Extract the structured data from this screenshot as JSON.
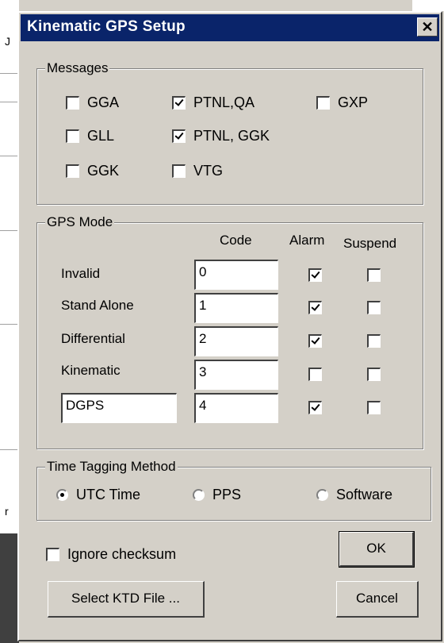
{
  "dialog": {
    "title": "Kinematic GPS Setup",
    "close_glyph": "✕"
  },
  "messages": {
    "legend": "Messages",
    "items": [
      {
        "label": "GGA",
        "checked": false
      },
      {
        "label": "PTNL,QA",
        "checked": true
      },
      {
        "label": "GXP",
        "checked": false
      },
      {
        "label": "GLL",
        "checked": false
      },
      {
        "label": "PTNL, GGK",
        "checked": true
      },
      {
        "label": "GGK",
        "checked": false
      },
      {
        "label": "VTG",
        "checked": false
      }
    ]
  },
  "gps_mode": {
    "legend": "GPS Mode",
    "headers": {
      "code": "Code",
      "alarm": "Alarm",
      "suspend": "Suspend"
    },
    "rows": [
      {
        "name": "Invalid",
        "code": "0",
        "alarm": true,
        "suspend": false
      },
      {
        "name": "Stand Alone",
        "code": "1",
        "alarm": true,
        "suspend": false
      },
      {
        "name": "Differential",
        "code": "2",
        "alarm": true,
        "suspend": false
      },
      {
        "name": "Kinematic",
        "code": "3",
        "alarm": false,
        "suspend": false
      },
      {
        "name": "DGPS",
        "code": "4",
        "alarm": true,
        "suspend": false
      }
    ]
  },
  "time_tagging": {
    "legend": "Time Tagging Method",
    "options": [
      {
        "label": "UTC Time",
        "selected": true
      },
      {
        "label": "PPS",
        "selected": false
      },
      {
        "label": "Software",
        "selected": false
      }
    ]
  },
  "ignore_checksum": {
    "label": "Ignore checksum",
    "checked": false
  },
  "buttons": {
    "ok": "OK",
    "select_ktd": "Select KTD File ...",
    "cancel": "Cancel"
  },
  "background": {
    "mark_top": "J",
    "mark_mid": "r"
  }
}
